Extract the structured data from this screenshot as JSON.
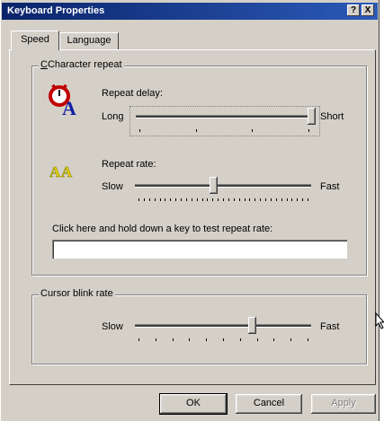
{
  "window": {
    "title": "Keyboard Properties",
    "help_glyph": "?",
    "close_glyph": "X"
  },
  "tabs": [
    {
      "label": "Speed",
      "selected": true
    },
    {
      "label": "Language",
      "selected": false
    }
  ],
  "char_repeat": {
    "group_label": "Character repeat",
    "delay": {
      "label": "Repeat delay:",
      "min_label": "Long",
      "max_label": "Short",
      "value_fraction": 1.0,
      "ticks": 4
    },
    "rate": {
      "label": "Repeat rate:",
      "min_label": "Slow",
      "max_label": "Fast",
      "value_fraction": 0.45,
      "ticks": 33
    },
    "test": {
      "label": "Click here and hold down a key to test repeat rate:",
      "value": ""
    }
  },
  "cursor_blink": {
    "group_label": "Cursor blink rate",
    "min_label": "Slow",
    "max_label": "Fast",
    "value_fraction": 0.67,
    "ticks": 11
  },
  "buttons": {
    "ok": "OK",
    "cancel": "Cancel",
    "apply": "Apply"
  },
  "colors": {
    "face": "#d4d0c8",
    "titlebar_start": "#0a246a",
    "titlebar_end": "#2c5ab8",
    "icon_red": "#c00000",
    "icon_blue": "#1020a0",
    "icon_yellow": "#e8d000"
  }
}
